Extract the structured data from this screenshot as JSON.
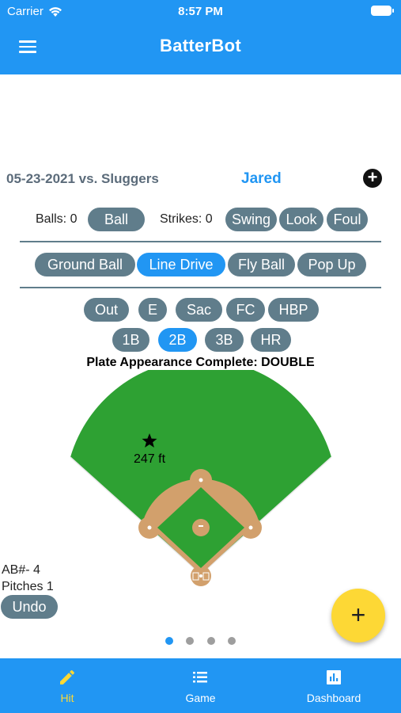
{
  "status_bar": {
    "carrier": "Carrier",
    "time": "8:57 PM"
  },
  "app_bar": {
    "title": "BatterBot"
  },
  "game_header": {
    "title": "05-23-2021 vs. Sluggers",
    "batter": "Jared"
  },
  "count": {
    "balls_label": "Balls: 0",
    "ball_button": "Ball",
    "strikes_label": "Strikes: 0",
    "strike_buttons": [
      "Swing",
      "Look",
      "Foul"
    ]
  },
  "hit_types": [
    {
      "label": "Ground Ball",
      "selected": false
    },
    {
      "label": "Line Drive",
      "selected": true
    },
    {
      "label": "Fly Ball",
      "selected": false
    },
    {
      "label": "Pop Up",
      "selected": false
    }
  ],
  "outcomes_row1": [
    {
      "label": "Out",
      "selected": false
    },
    {
      "label": "E",
      "selected": false
    },
    {
      "label": "Sac",
      "selected": false
    },
    {
      "label": "FC",
      "selected": false
    },
    {
      "label": "HBP",
      "selected": false
    }
  ],
  "outcomes_row2": [
    {
      "label": "1B",
      "selected": false
    },
    {
      "label": "2B",
      "selected": true
    },
    {
      "label": "3B",
      "selected": false
    },
    {
      "label": "HR",
      "selected": false
    }
  ],
  "result": {
    "text": "Plate Appearance Complete: DOUBLE"
  },
  "field": {
    "hit_marker_icon": "star-icon",
    "hit_distance": "247 ft",
    "grass_color": "#2ea133",
    "dirt_color": "#d2a06c"
  },
  "at_bat": {
    "ab_number": "AB#- 4",
    "pitches": "Pitches 1",
    "undo": "Undo"
  },
  "pager": {
    "pages": 4,
    "current": 1
  },
  "fab": {
    "icon": "plus-icon"
  },
  "bottom_nav": [
    {
      "label": "Hit",
      "icon": "pencil-icon",
      "active": true
    },
    {
      "label": "Game",
      "icon": "list-icon",
      "active": false
    },
    {
      "label": "Dashboard",
      "icon": "bar-chart-icon",
      "active": false
    }
  ],
  "colors": {
    "primary": "#2196f3",
    "pill": "#607d8b",
    "accent": "#fdd835"
  }
}
